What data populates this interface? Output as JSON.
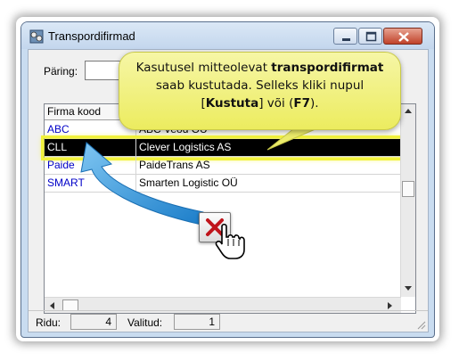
{
  "window": {
    "title": "Transpordifirmad",
    "icon": "truck-company-icon"
  },
  "query": {
    "label": "Päring:",
    "value": ""
  },
  "grid": {
    "columns": [
      "Firma kood",
      ""
    ],
    "rows": [
      {
        "code": "ABC",
        "name": "ABC Veod OÜ",
        "selected": false
      },
      {
        "code": "CLL",
        "name": "Clever Logistics AS",
        "selected": true
      },
      {
        "code": "Paide",
        "name": "PaideTrans AS",
        "selected": false
      },
      {
        "code": "SMART",
        "name": "Smarten Logistic OÜ",
        "selected": false
      }
    ]
  },
  "status": {
    "rows_label": "Ridu:",
    "rows_value": "4",
    "selected_label": "Valitud:",
    "selected_value": "1"
  },
  "callout": {
    "text_1": "Kasutusel mitteolevat ",
    "text_2": "transpordifirmat",
    "text_3": "saab kustutada.  Selleks kliki nupul",
    "text_4": "[",
    "text_5": "Kustuta",
    "text_6": "] või (",
    "text_7": "F7",
    "text_8": ")."
  },
  "colors": {
    "callout_fill": "#f0f07a",
    "highlight_outline": "#f2f23c",
    "arrow_blue": "#2f9ae0",
    "code_text": "#0000c8"
  }
}
